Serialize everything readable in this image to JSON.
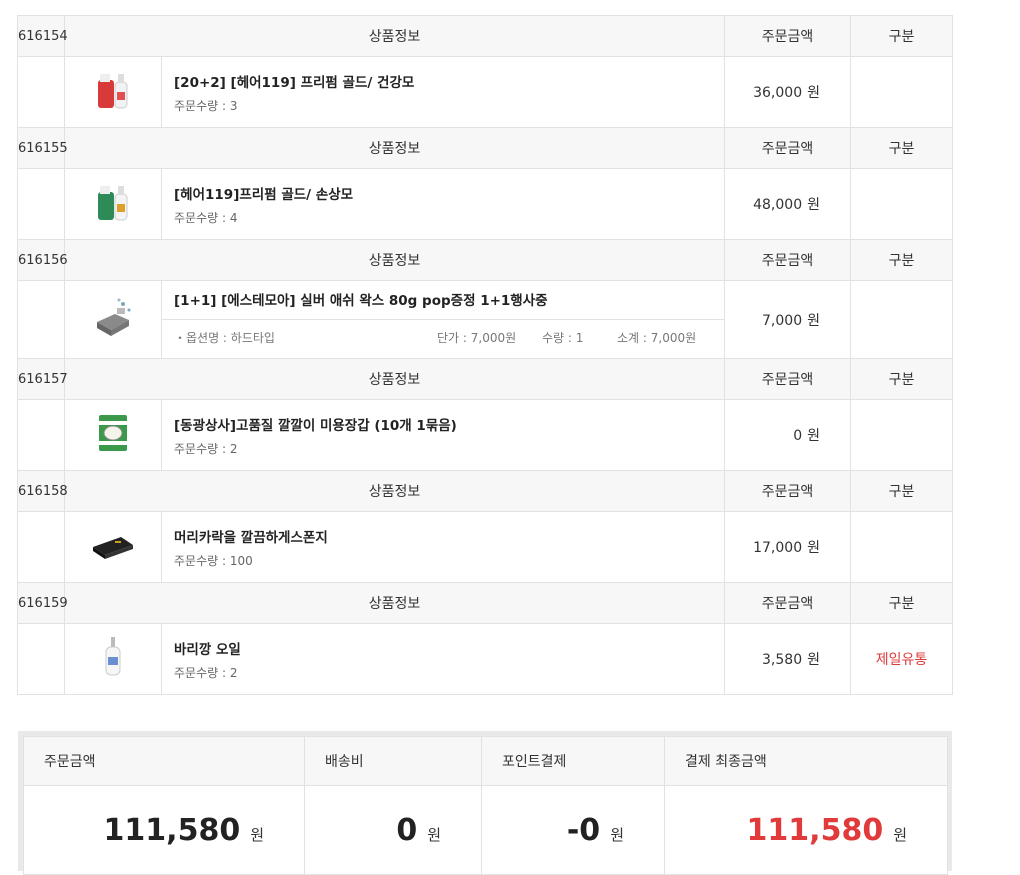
{
  "order_header": {
    "product_info": "상품정보",
    "order_amount": "주문금액",
    "category": "구분",
    "currency": "원"
  },
  "orders": [
    {
      "id": "616154",
      "name": "[20+2] [헤어119] 프리펌 골드/ 건강모",
      "qty": "주문수량 : 3",
      "amount": "36,000",
      "tag": ""
    },
    {
      "id": "616155",
      "name": "[헤어119]프리펌 골드/ 손상모",
      "qty": "주문수량 : 4",
      "amount": "48,000",
      "tag": ""
    },
    {
      "id": "616156",
      "name": "[1+1] [에스테모아] 실버 애쉬 왁스 80g pop증정 1+1행사중",
      "option": "・옵션명 : 하드타입",
      "unit_price": "단가 : 7,000원",
      "quantity": "수량 : 1",
      "subtotal": "소계 : 7,000원",
      "amount": "7,000",
      "tag": ""
    },
    {
      "id": "616157",
      "name": "[동광상사]고품질 깔깔이 미용장갑 (10개 1묶음)",
      "qty": "주문수량 : 2",
      "amount": "0",
      "tag": ""
    },
    {
      "id": "616158",
      "name": "머리카락을 깔끔하게스폰지",
      "qty": "주문수량 : 100",
      "amount": "17,000",
      "tag": ""
    },
    {
      "id": "616159",
      "name": "바리깡 오일",
      "qty": "주문수량 : 2",
      "amount": "3,580",
      "tag": "제일유통"
    }
  ],
  "summary": {
    "order_amount_label": "주문금액",
    "shipping_label": "배송비",
    "point_label": "포인트결제",
    "final_label": "결제 최종금액",
    "order_amount": "111,580",
    "shipping": "0",
    "point": "-0",
    "final": "111,580",
    "unit": "원"
  },
  "colors": {
    "accent_red": "#e03a3a",
    "header_bg": "#f7f7f7",
    "border": "#e2e2e2"
  },
  "thumbnails": [
    "hair-product-bottles-red",
    "hair-product-bottles-green",
    "wax-gift-box",
    "glove-pack",
    "black-sponge",
    "oil-bottle"
  ]
}
